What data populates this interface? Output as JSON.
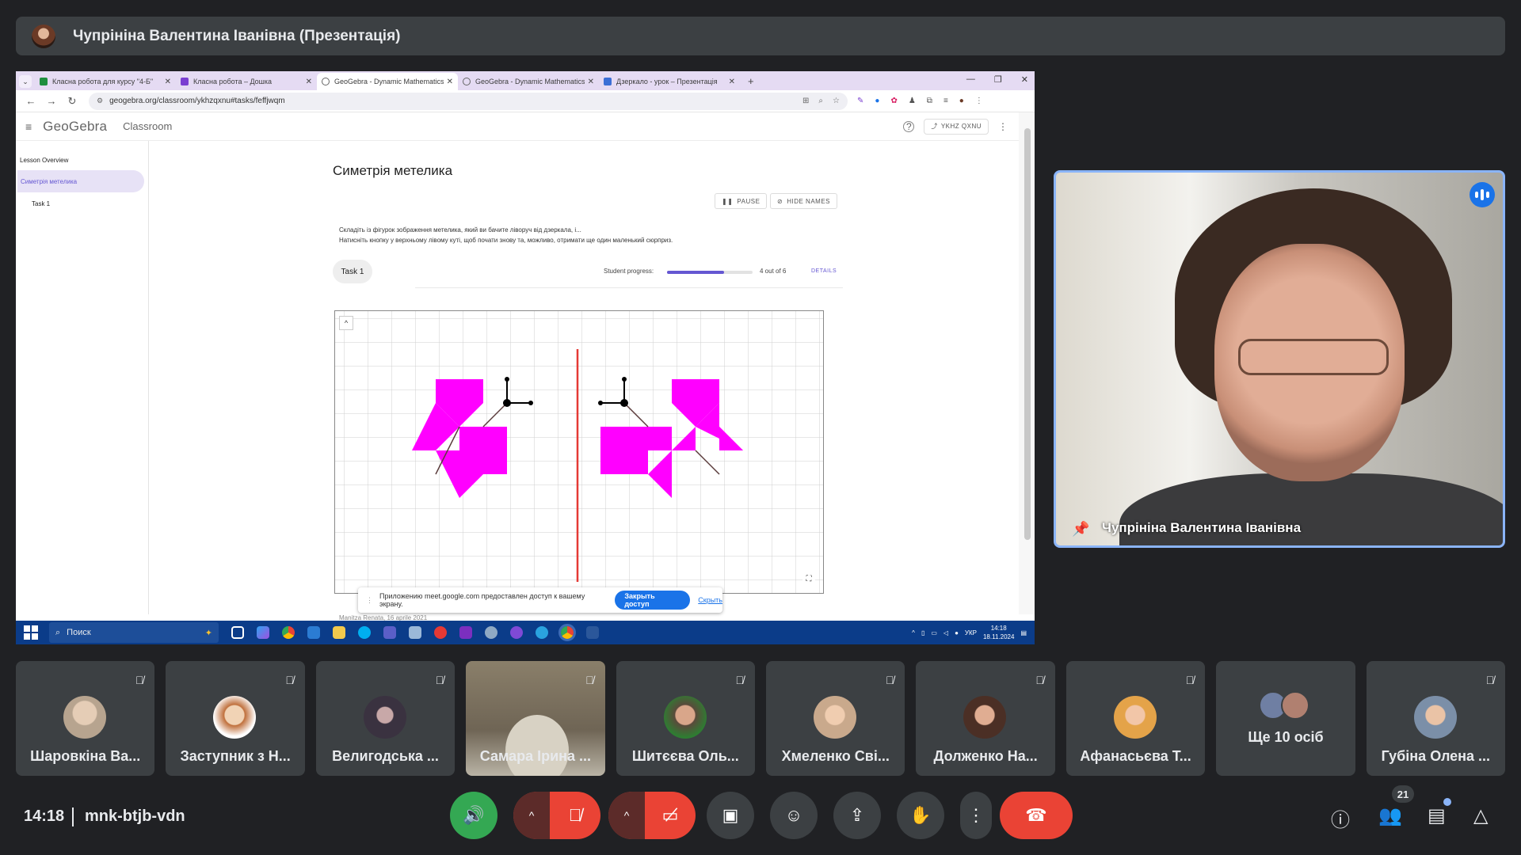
{
  "meet": {
    "presenter_title": "Чупрініна Валентина Іванівна (Презентація)",
    "clock": "14:18",
    "meeting_code": "mnk-btjb-vdn",
    "participant_count": "21"
  },
  "browser": {
    "tabs": [
      {
        "label": "Класна робота для курсу \"4-Б\"",
        "favicon_color": "#1e8e3e"
      },
      {
        "label": "Класна робота – Дошка",
        "favicon_color": "#7a3fd1"
      },
      {
        "label": "GeoGebra - Dynamic Mathematics",
        "favicon_color": "#666666"
      },
      {
        "label": "GeoGebra - Dynamic Mathematics",
        "favicon_color": "#666666"
      },
      {
        "label": "Дзеркало - урок – Презентація",
        "favicon_color": "#3b6fd6"
      }
    ],
    "active_tab": 2,
    "url": "geogebra.org/classroom/ykhzqxnu#tasks/feffjwqm"
  },
  "geogebra": {
    "logo": "GeoGebra",
    "section": "Classroom",
    "share_code": "YKHZ QXNU",
    "sidebar": {
      "overview": "Lesson Overview",
      "active_lesson": "Симетрія метелика",
      "task": "Task 1"
    },
    "page_title": "Симетрія метелика",
    "pause_label": "PAUSE",
    "hide_names_label": "HIDE NAMES",
    "description_line1": "Складіть із фігурок зображення метелика, який ви бачите ліворуч від дзеркала, і...",
    "description_line2": "Натисніть кнопку у верхньому лівому куті, щоб почати знову та, можливо, отримати ще один маленький сюрприз.",
    "task_label": "Task 1",
    "progress_label": "Student progress:",
    "progress_value": 0.67,
    "progress_count": "4 out of 6",
    "details_label": "DETAILS",
    "shape_color": "#ff00ff",
    "mirror_color": "#e53935",
    "footnote": "Manitza Renata, 16 aprile 2021"
  },
  "share_notice": {
    "text": "Приложению meet.google.com предоставлен доступ к вашему экрану.",
    "stop_label": "Закрыть доступ",
    "hide_label": "Скрыть"
  },
  "windows_taskbar": {
    "search_placeholder": "Поиск",
    "lang": "УКР",
    "time": "14:18",
    "date": "18.11.2024"
  },
  "pinned": {
    "name": "Чупрініна Валентина Іванівна"
  },
  "participants": [
    {
      "name": "Шаровкіна Ва...",
      "avatar": "#b7a48f"
    },
    {
      "name": "Заступник з Н...",
      "avatar": "#d8a77a"
    },
    {
      "name": "Велигодська ...",
      "avatar": "#3a3240"
    },
    {
      "name": "Самара Ірина ...",
      "avatar": "#cfc9b9"
    },
    {
      "name": "Шитєєва Оль...",
      "avatar": "#5a4a3b"
    },
    {
      "name": "Хмеленко Сві...",
      "avatar": "#c9a98c"
    },
    {
      "name": "Долженко На...",
      "avatar": "#4b2f25"
    },
    {
      "name": "Афанасьєва Т...",
      "avatar": "#e4a349"
    },
    {
      "name": "Ще 10 осіб",
      "avatar": "#6f7fa3"
    },
    {
      "name": "Губіна Олена ...",
      "avatar": "#7b8fa8"
    }
  ]
}
